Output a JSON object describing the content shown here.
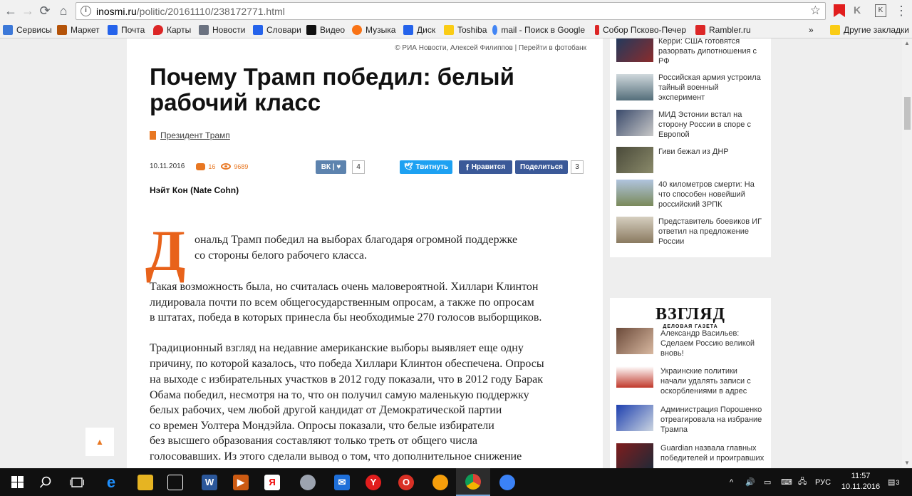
{
  "browser": {
    "url_host": "inosmi.ru",
    "url_path": "/politic/20161110/238172771.html",
    "bookmarks": [
      {
        "label": "Сервисы",
        "color": "#3c78d8"
      },
      {
        "label": "Маркет",
        "color": "#b45309"
      },
      {
        "label": "Почта",
        "color": "#2563eb"
      },
      {
        "label": "Карты",
        "color": "#dc2626"
      },
      {
        "label": "Новости",
        "color": "#6b7280"
      },
      {
        "label": "Словари",
        "color": "#2563eb"
      },
      {
        "label": "Видео",
        "color": "#111111"
      },
      {
        "label": "Музыка",
        "color": "#f97316"
      },
      {
        "label": "Диск",
        "color": "#2563eb"
      },
      {
        "label": "Toshiba",
        "color": "#facc15"
      },
      {
        "label": "mail - Поиск в Google",
        "color": "#4285f4"
      },
      {
        "label": "Собор Псково-Печер",
        "color": "#dc2626"
      },
      {
        "label": "Rambler.ru",
        "color": "#dc2626"
      }
    ],
    "bookmarks_more": "»",
    "other_bookmarks": "Другие закладки"
  },
  "article": {
    "photo_credit": "© РИА Новости, Алексей Филиппов | Перейти в фотобанк",
    "title": "Почему Трамп победил: белый рабочий класс",
    "tag": "Президент Трамп",
    "date": "10.11.2016",
    "comments": "16",
    "views": "9689",
    "vk_label": "ВК",
    "vk_count": "4",
    "tweet_label": "Твитнуть",
    "fb_label": "Нравится",
    "share_label": "Поделиться",
    "share_count": "3",
    "author": "Нэйт Кон (Nate Cohn)",
    "dropcap": "Д",
    "p1_l1": "ональд Трамп победил на выборах благодаря огромной поддержке",
    "p1_l2": "со стороны белого рабочего класса.",
    "p2_l1": "Такая возможность была, но считалась очень маловероятной. Хиллари Клинтон",
    "p2_l2": "лидировала почти по всем общегосударственным опросам, а также по опросам",
    "p2_l3": "в штатах, победа в которых принесла бы необходимые 270 голосов выборщиков.",
    "p3_l1": "Традиционный взгляд на недавние американские выборы выявляет еще одну",
    "p3_l2": "причину, по которой казалось, что победа Хиллари Клинтон обеспечена. Опросы",
    "p3_l3": "на выходе с избирательных участков в 2012 году показали, что в 2012 году Барак",
    "p3_l4": "Обама победил, несмотря на то, что он получил самую маленькую поддержку",
    "p3_l5": "белых рабочих, чем любой другой кандидат от Демократической партии",
    "p3_l6": "со времен Уолтера Мондэйла. Опросы показали, что белые избиратели",
    "p3_l7": "без высшего образования составляют только треть от общего числа",
    "p3_l8": "голосовавших. Из этого сделали вывод о том, что дополнительное снижение"
  },
  "sidebar": {
    "top_news": [
      {
        "text": "Керри: США готовятся разорвать дипотношения с РФ"
      },
      {
        "text": "Российская армия устроила тайный военный эксперимент"
      },
      {
        "text": "МИД Эстонии встал на сторону России в споре с Европой"
      },
      {
        "text": "Гиви бежал из ДНР"
      },
      {
        "text": "40 километров смерти: На что способен новейший российский ЗРПК"
      },
      {
        "text": "Представитель боевиков ИГ ответил на предложение России"
      }
    ],
    "vz_logo": "ВЗГЛЯД",
    "vz_sub": "ДЕЛОВАЯ ГАЗЕТА",
    "vz_news": [
      {
        "text": "Александр Васильев: Сделаем Россию великой вновь!"
      },
      {
        "text": "Украинские политики начали удалять записи с оскорблениями в адрес"
      },
      {
        "text": "Администрация Порошенко отреагировала на избрание Трампа"
      },
      {
        "text": "Guardian назвала главных победителей и проигравших от победы"
      }
    ]
  },
  "taskbar": {
    "lang": "РУС",
    "time": "11:57",
    "date": "10.11.2016",
    "notif_count": "3"
  }
}
